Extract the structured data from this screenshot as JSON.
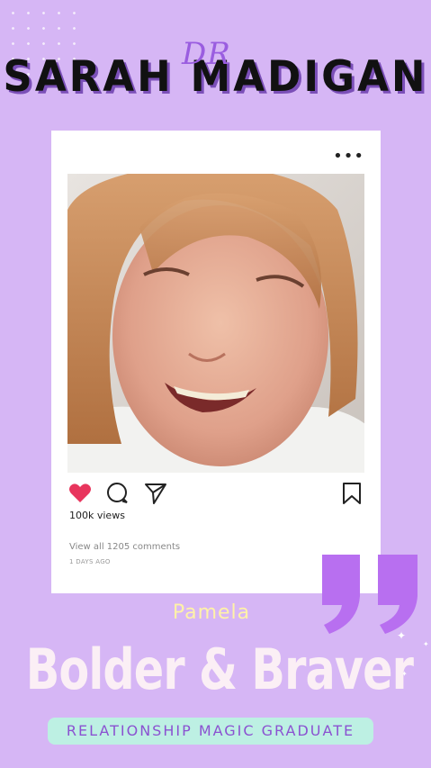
{
  "logo": {
    "prefix": "DR",
    "name": "SARAH MADIGAN"
  },
  "post": {
    "menu_icon": "more-horizontal-icon",
    "photo_description_icon": "portrait-photo",
    "icons": {
      "like": "heart-icon",
      "comment": "comment-icon",
      "share": "send-icon",
      "save": "bookmark-icon"
    },
    "views": "100k views",
    "comments_link": "View all 1205 comments",
    "posted": "1 DAYS AGO",
    "like_color": "#e8355d"
  },
  "testimonial": {
    "person": "Pamela",
    "headline": "Bolder & Braver",
    "badge": "RELATIONSHIP MAGIC GRADUATE"
  },
  "colors": {
    "background": "#d6b6f5",
    "quote": "#b86ff0",
    "badge_bg": "#bdf0e3",
    "badge_text": "#8b52d1",
    "person_text": "#fff2a8"
  }
}
